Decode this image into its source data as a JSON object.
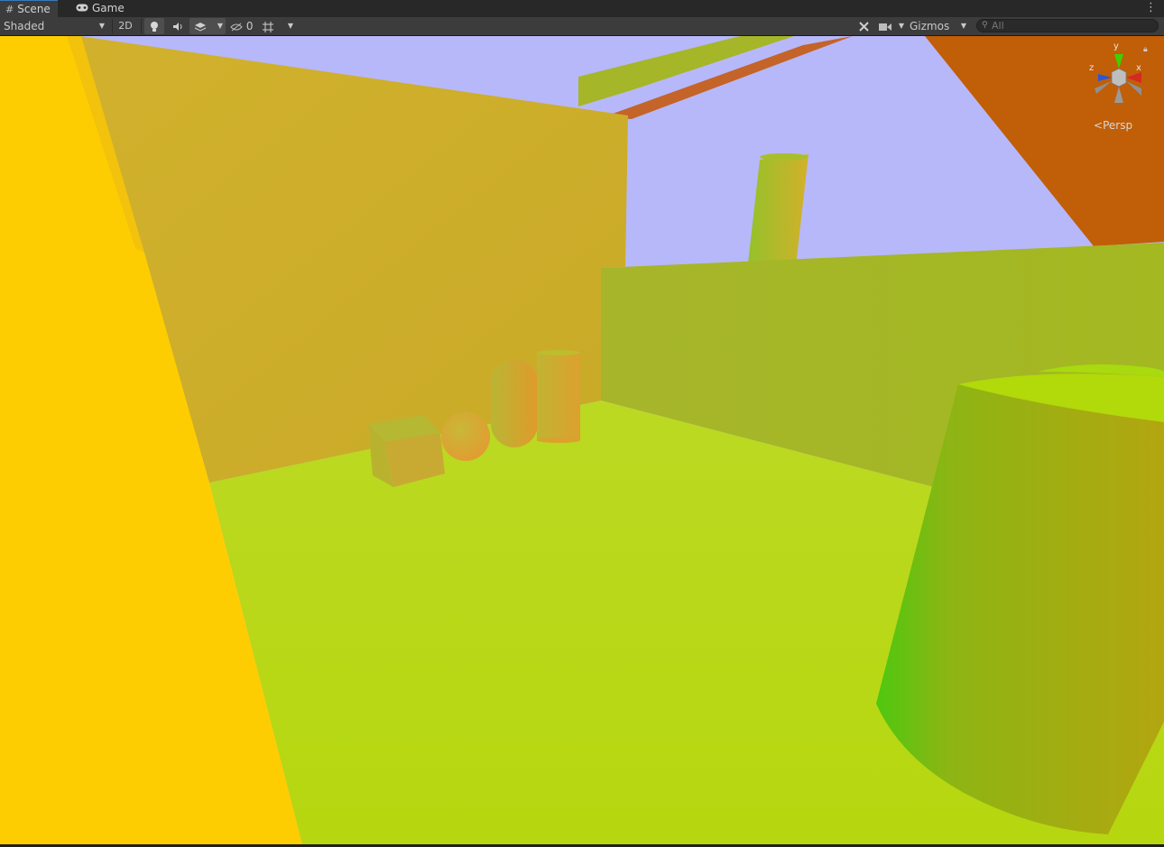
{
  "window": {
    "tabs": [
      {
        "label": "Scene",
        "icon": "grid-icon"
      },
      {
        "label": "Game",
        "icon": "gamepad-icon"
      }
    ],
    "menu_icon": "kebab-menu-icon"
  },
  "toolbar": {
    "draw_mode": "Shaded",
    "mode_2d": "2D",
    "hidden_count": "0",
    "gizmos_label": "Gizmos"
  },
  "search": {
    "placeholder": "All"
  },
  "scene_view": {
    "projection_label": "Persp",
    "axes": {
      "x": "x",
      "y": "y",
      "z": "z"
    },
    "sky_color": "#b7b8fa",
    "floor_color": "#b7d81c",
    "wall_color": "#cdb02a",
    "accent_color": "#3a79bb"
  }
}
